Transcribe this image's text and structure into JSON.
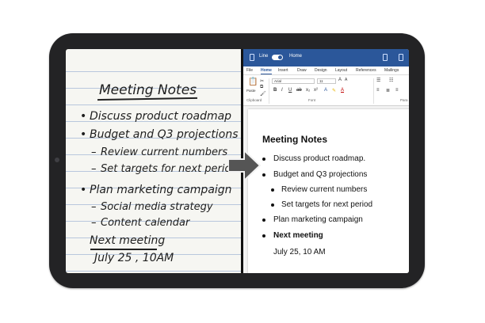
{
  "notebook": {
    "title": "Meeting Notes",
    "item1": "Discuss product roadmap",
    "item2": "Budget and Q3 projections",
    "sub1": "Review current numbers",
    "sub2": "Set targets for next period",
    "item3": "Plan marketing campaign",
    "sub3": "Social media strategy",
    "sub4": "Content calendar",
    "next": "Next meeting",
    "date": "July 25 , 10AM"
  },
  "word": {
    "titlebar": {
      "line_label": "Line",
      "home_label": "Home"
    },
    "tabs": [
      "File",
      "Home",
      "Insert",
      "Draw",
      "Design",
      "Layout",
      "References",
      "Mailings"
    ],
    "ribbon": {
      "paste": "Paste",
      "font_name": "Arial",
      "font_size": "11",
      "clipboard": "Clipboard",
      "font_group": "Font",
      "para_group": "Para"
    },
    "doc": {
      "title": "Meeting Notes",
      "items": [
        "Discuss product roadmap.",
        "Budget and Q3 projections",
        "Review current numbers",
        "Set targets for next period",
        "Plan marketing campaign",
        "Next meeting"
      ],
      "date": "July 25, 10 AM"
    }
  },
  "colors": {
    "word_blue": "#2b579a",
    "arrow": "#555555",
    "bezel": "#232325"
  }
}
